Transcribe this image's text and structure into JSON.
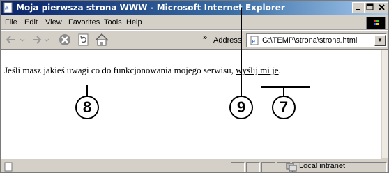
{
  "window": {
    "title": "Moja pierwsza strona WWW - Microsoft Internet Explorer"
  },
  "menu": {
    "items": [
      {
        "label": "File"
      },
      {
        "label": "Edit"
      },
      {
        "label": "View"
      },
      {
        "label": "Favorites"
      },
      {
        "label": "Tools"
      },
      {
        "label": "Help"
      }
    ]
  },
  "toolbar": {
    "address_label": "Address",
    "address_value": "G:\\TEMP\\strona\\strona.html"
  },
  "content": {
    "text": "Jeśli masz jakieś uwagi co do funkcjonowania mojego serwisu, ",
    "link": "wyślij mi je",
    "suffix": "."
  },
  "status": {
    "zone": "Local intranet"
  },
  "callouts": [
    {
      "label": "8"
    },
    {
      "label": "9"
    },
    {
      "label": "7"
    }
  ]
}
